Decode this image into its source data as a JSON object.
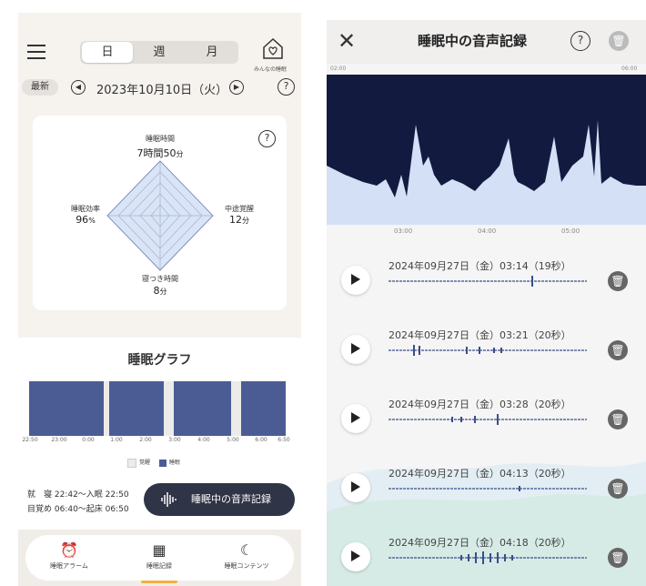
{
  "left": {
    "tabs": [
      {
        "label": "日",
        "selected": true
      },
      {
        "label": "週",
        "selected": false
      },
      {
        "label": "月",
        "selected": false
      }
    ],
    "home_label": "みんなの睡眠",
    "latest_label": "最新",
    "date": "2023年10月10日（火）",
    "question_glyph": "?",
    "radar": {
      "top": {
        "label": "睡眠時間",
        "value": "7時間50",
        "unit": "分"
      },
      "right": {
        "label": "中途覚醒",
        "value": "12",
        "unit": "分"
      },
      "bottom": {
        "label": "寝つき時間",
        "value": "8",
        "unit": "分"
      },
      "left": {
        "label": "睡眠効率",
        "value": "96",
        "unit": "%"
      }
    },
    "graph": {
      "title": "睡眠グラフ",
      "ticks": [
        "22:50",
        "23:00",
        "0:00",
        "1:00",
        "2:00",
        "3:00",
        "4:00",
        "5:00",
        "6:00",
        "6:50"
      ],
      "legend_awake": "覚醒",
      "legend_sleep": "睡眠",
      "colors": {
        "sleep": "#4b5c94",
        "awake": "#ecebe8"
      }
    },
    "bedtime": "就　寝 22:42〜入眠 22:50",
    "wake": "目覚め 06:40〜起床 06:50",
    "audio_button": "睡眠中の音声記録",
    "nav": [
      {
        "label": "睡眠アラーム",
        "icon": "alarm-icon",
        "glyph": "⏰"
      },
      {
        "label": "睡眠記録",
        "icon": "record-icon",
        "glyph": "▦"
      },
      {
        "label": "睡眠コンテンツ",
        "icon": "moon-icon",
        "glyph": "☾"
      }
    ]
  },
  "right": {
    "title": "睡眠中の音声記録",
    "close_glyph": "✕",
    "question_glyph": "?",
    "trash_glyph": "🗑",
    "chart_start": "02:00",
    "chart_end": "06:00",
    "chart_ticks": [
      "03:00",
      "04:00",
      "05:00"
    ],
    "chart_colors": {
      "background": "#121a40",
      "fill": "#d3e0f5"
    },
    "recordings": [
      {
        "text": "2024年09月27日（金）03:14（19秒）"
      },
      {
        "text": "2024年09月27日（金）03:21（20秒）"
      },
      {
        "text": "2024年09月27日（金）03:28（20秒）"
      },
      {
        "text": "2024年09月27日（金）04:13（20秒）"
      },
      {
        "text": "2024年09月27日（金）04:18（20秒）"
      }
    ]
  }
}
